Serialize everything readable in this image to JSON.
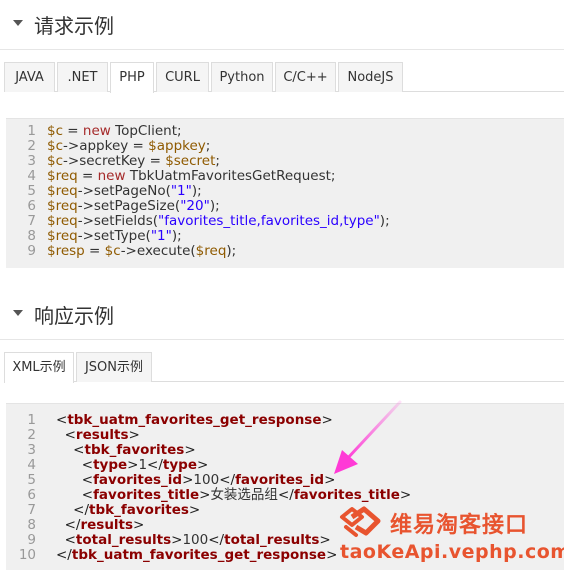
{
  "request_section": {
    "title": "请求示例"
  },
  "request_tabs": [
    "JAVA",
    ".NET",
    "PHP",
    "CURL",
    "Python",
    "C/C++",
    "NodeJS"
  ],
  "request_active_tab": "PHP",
  "request_code": [
    [
      [
        "var",
        "$c"
      ],
      [
        "plain",
        " = "
      ],
      [
        "kw",
        "new"
      ],
      [
        "plain",
        " TopClient;"
      ]
    ],
    [
      [
        "var",
        "$c"
      ],
      [
        "plain",
        "->appkey = "
      ],
      [
        "var",
        "$appkey"
      ],
      [
        "plain",
        ";"
      ]
    ],
    [
      [
        "var",
        "$c"
      ],
      [
        "plain",
        "->secretKey = "
      ],
      [
        "var",
        "$secret"
      ],
      [
        "plain",
        ";"
      ]
    ],
    [
      [
        "var",
        "$req"
      ],
      [
        "plain",
        " = "
      ],
      [
        "kw",
        "new"
      ],
      [
        "plain",
        " TbkUatmFavoritesGetRequest;"
      ]
    ],
    [
      [
        "var",
        "$req"
      ],
      [
        "plain",
        "->setPageNo("
      ],
      [
        "str",
        "\"1\""
      ],
      [
        "plain",
        ");"
      ]
    ],
    [
      [
        "var",
        "$req"
      ],
      [
        "plain",
        "->setPageSize("
      ],
      [
        "str",
        "\"20\""
      ],
      [
        "plain",
        ");"
      ]
    ],
    [
      [
        "var",
        "$req"
      ],
      [
        "plain",
        "->setFields("
      ],
      [
        "str",
        "\"favorites_title,favorites_id,type\""
      ],
      [
        "plain",
        ");"
      ]
    ],
    [
      [
        "var",
        "$req"
      ],
      [
        "plain",
        "->setType("
      ],
      [
        "str",
        "\"1\""
      ],
      [
        "plain",
        ");"
      ]
    ],
    [
      [
        "var",
        "$resp"
      ],
      [
        "plain",
        " = "
      ],
      [
        "var",
        "$c"
      ],
      [
        "plain",
        "->execute("
      ],
      [
        "var",
        "$req"
      ],
      [
        "plain",
        ");"
      ]
    ]
  ],
  "response_section": {
    "title": "响应示例"
  },
  "response_tabs": [
    "XML示例",
    "JSON示例"
  ],
  "response_active_tab": "XML示例",
  "response_code": [
    [
      [
        "punct",
        "<"
      ],
      [
        "tag",
        "tbk_uatm_favorites_get_response"
      ],
      [
        "punct",
        ">"
      ]
    ],
    [
      [
        "plain",
        "  "
      ],
      [
        "punct",
        "<"
      ],
      [
        "tag",
        "results"
      ],
      [
        "punct",
        ">"
      ]
    ],
    [
      [
        "plain",
        "    "
      ],
      [
        "punct",
        "<"
      ],
      [
        "tag",
        "tbk_favorites"
      ],
      [
        "punct",
        ">"
      ]
    ],
    [
      [
        "plain",
        "      "
      ],
      [
        "punct",
        "<"
      ],
      [
        "tag",
        "type"
      ],
      [
        "punct",
        ">"
      ],
      [
        "plain",
        "1"
      ],
      [
        "punct",
        "</"
      ],
      [
        "tag",
        "type"
      ],
      [
        "punct",
        ">"
      ]
    ],
    [
      [
        "plain",
        "      "
      ],
      [
        "punct",
        "<"
      ],
      [
        "tag",
        "favorites_id"
      ],
      [
        "punct",
        ">"
      ],
      [
        "plain",
        "100"
      ],
      [
        "punct",
        "</"
      ],
      [
        "tag",
        "favorites_id"
      ],
      [
        "punct",
        ">"
      ]
    ],
    [
      [
        "plain",
        "      "
      ],
      [
        "punct",
        "<"
      ],
      [
        "tag",
        "favorites_title"
      ],
      [
        "punct",
        ">"
      ],
      [
        "plain",
        "女装选品组"
      ],
      [
        "punct",
        "</"
      ],
      [
        "tag",
        "favorites_title"
      ],
      [
        "punct",
        ">"
      ]
    ],
    [
      [
        "plain",
        "    "
      ],
      [
        "punct",
        "</"
      ],
      [
        "tag",
        "tbk_favorites"
      ],
      [
        "punct",
        ">"
      ]
    ],
    [
      [
        "plain",
        "  "
      ],
      [
        "punct",
        "</"
      ],
      [
        "tag",
        "results"
      ],
      [
        "punct",
        ">"
      ]
    ],
    [
      [
        "plain",
        "  "
      ],
      [
        "punct",
        "<"
      ],
      [
        "tag",
        "total_results"
      ],
      [
        "punct",
        ">"
      ],
      [
        "plain",
        "100"
      ],
      [
        "punct",
        "</"
      ],
      [
        "tag",
        "total_results"
      ],
      [
        "punct",
        ">"
      ]
    ],
    [
      [
        "punct",
        "</"
      ],
      [
        "tag",
        "tbk_uatm_favorites_get_response"
      ],
      [
        "punct",
        ">"
      ]
    ]
  ],
  "watermark": {
    "title": "维易淘客接口",
    "url": "taoKeApi.vephp.com"
  },
  "colors": {
    "watermark": "#e8542f",
    "arrow": "#ff3ad6"
  }
}
